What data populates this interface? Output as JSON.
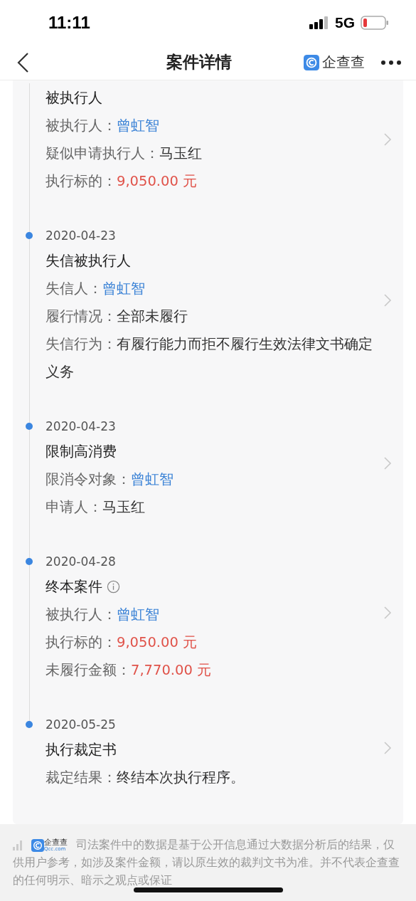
{
  "status_bar": {
    "time": "11:11",
    "network": "5G"
  },
  "header": {
    "title": "案件详情",
    "brand": "企查查"
  },
  "timeline": [
    {
      "title": "被执行人",
      "info": false,
      "fields": [
        {
          "label": "被执行人：",
          "value": "曾虹智",
          "kind": "link"
        },
        {
          "label": "疑似申请执行人：",
          "value": "马玉红",
          "kind": "text"
        },
        {
          "label": "执行标的：",
          "value": "9,050.00 元",
          "kind": "money"
        }
      ]
    },
    {
      "date": "2020-04-23",
      "title": "失信被执行人",
      "info": false,
      "fields": [
        {
          "label": "失信人：",
          "value": "曾虹智",
          "kind": "link"
        },
        {
          "label": "履行情况：",
          "value": "全部未履行",
          "kind": "text"
        },
        {
          "label": "失信行为：",
          "value": "有履行能力而拒不履行生效法律文书确定义务",
          "kind": "text"
        }
      ]
    },
    {
      "date": "2020-04-23",
      "title": "限制高消费",
      "info": false,
      "fields": [
        {
          "label": "限消令对象：",
          "value": "曾虹智",
          "kind": "link"
        },
        {
          "label": "申请人：",
          "value": "马玉红",
          "kind": "text"
        }
      ]
    },
    {
      "date": "2020-04-28",
      "title": "终本案件",
      "info": true,
      "fields": [
        {
          "label": "被执行人：",
          "value": "曾虹智",
          "kind": "link"
        },
        {
          "label": "执行标的：",
          "value": "9,050.00 元",
          "kind": "money"
        },
        {
          "label": "未履行金额：",
          "value": "7,770.00 元",
          "kind": "money"
        }
      ]
    },
    {
      "date": "2020-05-25",
      "title": "执行裁定书",
      "info": false,
      "fields": [
        {
          "label": "裁定结果：",
          "value": "终结本次执行程序。",
          "kind": "text"
        }
      ]
    }
  ],
  "footer": {
    "logo_text": "企查查",
    "logo_sub": "Qcc.com",
    "disclaimer": "司法案件中的数据是基于公开信息通过大数据分析后的结果，仅供用户参考，如涉及案件金额，请以原生效的裁判文书为准。并不代表企查查的任何明示、暗示之观点或保证"
  }
}
